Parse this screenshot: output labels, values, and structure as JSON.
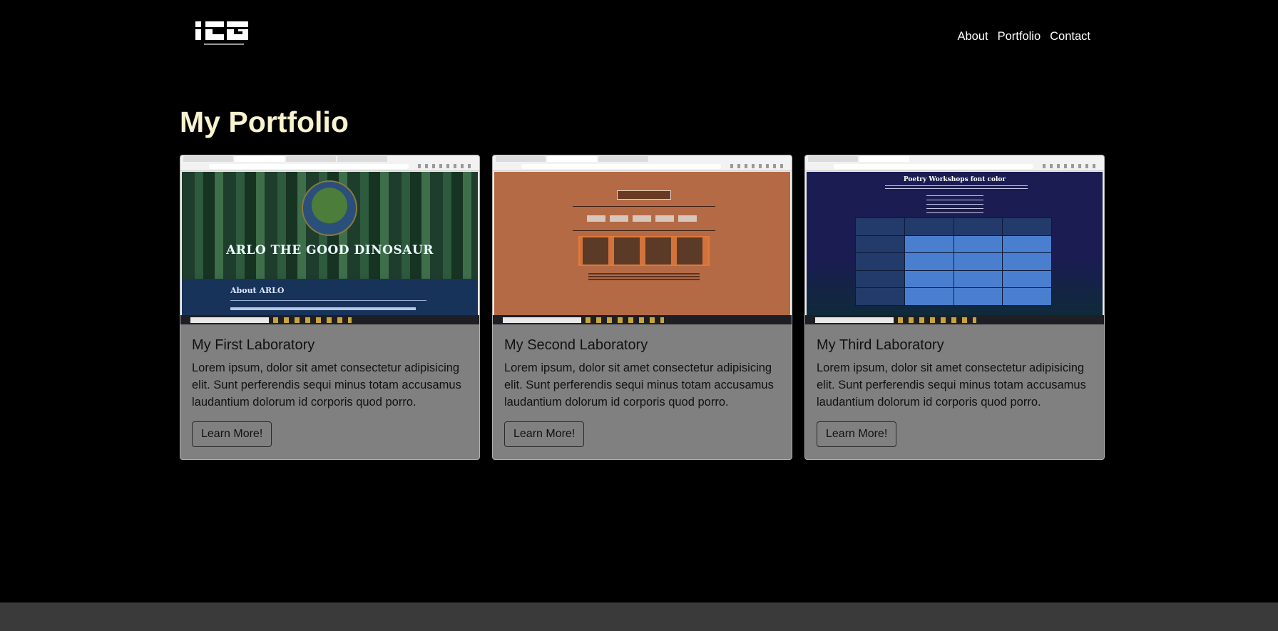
{
  "nav": {
    "logo_name": "ICG logo",
    "links": [
      "About",
      "Portfolio",
      "Contact"
    ]
  },
  "page": {
    "title": "My Portfolio"
  },
  "cards": [
    {
      "title": "My First Laboratory",
      "text": "Lorem ipsum, dolor sit amet consectetur adipisicing elit. Sunt perferendis sequi minus totam accusamus laudantium dolorum id corporis quod porro.",
      "button": "Learn More!",
      "thumb": {
        "heading": "ARLO THE GOOD DINOSAUR",
        "section": "About ARLO"
      }
    },
    {
      "title": "My Second Laboratory",
      "text": "Lorem ipsum, dolor sit amet consectetur adipisicing elit. Sunt perferendis sequi minus totam accusamus laudantium dolorum id corporis quod porro.",
      "button": "Learn More!"
    },
    {
      "title": "My Third Laboratory",
      "text": "Lorem ipsum, dolor sit amet consectetur adipisicing elit. Sunt perferendis sequi minus totam accusamus laudantium dolorum id corporis quod porro.",
      "button": "Learn More!",
      "thumb": {
        "heading": "Poetry Workshops font color"
      }
    }
  ],
  "colors": {
    "background": "#000000",
    "title": "#f8f2cf",
    "card": "#808080",
    "footer": "#3a3a3a"
  }
}
